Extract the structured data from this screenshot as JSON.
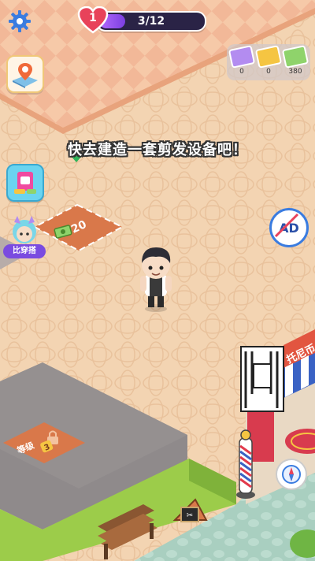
{
  "hud": {
    "level": "1",
    "progress_text": "3/12",
    "progress_fraction": 0.25
  },
  "currencies": [
    {
      "name": "shirt-token",
      "value": "0",
      "color": "#b38cf0"
    },
    {
      "name": "gold-ticket",
      "value": "0",
      "color": "#f5c542"
    },
    {
      "name": "cash",
      "value": "380",
      "color": "#8fd36b"
    }
  ],
  "dialog": {
    "text": "快去建造一套剪发设备吧！"
  },
  "buttons": {
    "outfit_label": "比穿搭",
    "ad_label": "AD"
  },
  "map": {
    "build_cost": "20",
    "locked_label": "等级",
    "locked_level": "3",
    "shop_sign": "托尼币"
  },
  "colors": {
    "accent_purple": "#7b3fe0",
    "heart_red": "#e8425a",
    "floor_peach": "#f3d4b2",
    "grass_green": "#9ccc4a"
  }
}
